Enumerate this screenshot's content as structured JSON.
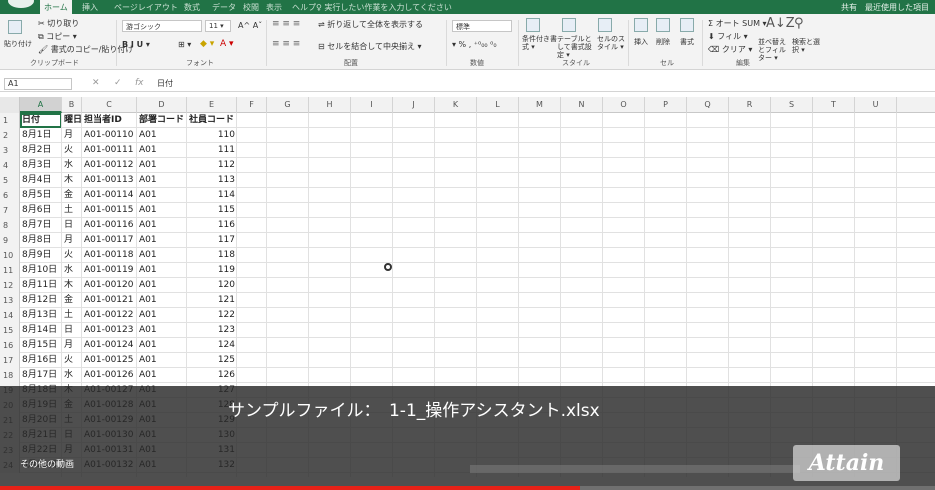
{
  "tabs": [
    "ホーム",
    "挿入",
    "ページレイアウト",
    "数式",
    "データ",
    "校閲",
    "表示",
    "ヘルプ",
    "♀ 実行したい作業を入力してください"
  ],
  "account": "共有　最近使用した項目",
  "ribbon": {
    "paste": "貼り付け",
    "cut": "✂ 切り取り",
    "copy": "⧉ コピー ▾",
    "format_painter": "🖌 書式のコピー/貼り付け",
    "font_name": "游ゴシック",
    "font_size": "11 ▾",
    "font_grow": "A^ Aˇ",
    "biu": "B  I  U ▾",
    "border": "⊞ ▾",
    "fill": "◆ ▾",
    "font_color": "A ▾",
    "align_icons": "≡ ≡ ≡",
    "wrap_text": "⇌ 折り返して全体を表示する",
    "merge_center": "⊟ セルを結合して中央揃え ▾",
    "number_format": "標準",
    "number_buttons": "▾ % , ⁺⁰₀₀ ⁰₀",
    "cond_format": "条件付き書式 ▾",
    "table_format": "テーブルとして書式設定 ▾",
    "cell_styles": "セルのスタイル ▾",
    "insert": "挿入",
    "delete": "削除",
    "format": "書式",
    "autosum": "Σ オート SUM ▾",
    "fill_btn": "⬇ フィル ▾",
    "clear": "⌫ クリア ▾",
    "sort_icon": "A↓Z",
    "find_icon": "⚲",
    "sort_filter": "並べ替えとフィルター ▾",
    "find_select": "検索と選択 ▾",
    "groups": [
      "クリップボード",
      "フォント",
      "配置",
      "数値",
      "スタイル",
      "セル",
      "編集"
    ]
  },
  "formula_bar": {
    "name_box": "A1",
    "cancel": "✕",
    "enter": "✓",
    "fx": "fx",
    "value": "日付"
  },
  "columns": [
    "A",
    "B",
    "C",
    "D",
    "E",
    "F",
    "G",
    "H",
    "I",
    "J",
    "K",
    "L",
    "M",
    "N",
    "O",
    "P",
    "Q",
    "R",
    "S",
    "T",
    "U"
  ],
  "header_row": [
    "日付",
    "曜日",
    "担当者ID",
    "部署コード",
    "社員コード"
  ],
  "rows": [
    [
      "8月1日",
      "月",
      "A01-00110",
      "A01",
      "110"
    ],
    [
      "8月2日",
      "火",
      "A01-00111",
      "A01",
      "111"
    ],
    [
      "8月3日",
      "水",
      "A01-00112",
      "A01",
      "112"
    ],
    [
      "8月4日",
      "木",
      "A01-00113",
      "A01",
      "113"
    ],
    [
      "8月5日",
      "金",
      "A01-00114",
      "A01",
      "114"
    ],
    [
      "8月6日",
      "土",
      "A01-00115",
      "A01",
      "115"
    ],
    [
      "8月7日",
      "日",
      "A01-00116",
      "A01",
      "116"
    ],
    [
      "8月8日",
      "月",
      "A01-00117",
      "A01",
      "117"
    ],
    [
      "8月9日",
      "火",
      "A01-00118",
      "A01",
      "118"
    ],
    [
      "8月10日",
      "水",
      "A01-00119",
      "A01",
      "119"
    ],
    [
      "8月11日",
      "木",
      "A01-00120",
      "A01",
      "120"
    ],
    [
      "8月12日",
      "金",
      "A01-00121",
      "A01",
      "121"
    ],
    [
      "8月13日",
      "土",
      "A01-00122",
      "A01",
      "122"
    ],
    [
      "8月14日",
      "日",
      "A01-00123",
      "A01",
      "123"
    ],
    [
      "8月15日",
      "月",
      "A01-00124",
      "A01",
      "124"
    ],
    [
      "8月16日",
      "火",
      "A01-00125",
      "A01",
      "125"
    ],
    [
      "8月17日",
      "水",
      "A01-00126",
      "A01",
      "126"
    ],
    [
      "8月18日",
      "木",
      "A01-00127",
      "A01",
      "127"
    ],
    [
      "8月19日",
      "金",
      "A01-00128",
      "A01",
      "128"
    ],
    [
      "8月20日",
      "土",
      "A01-00129",
      "A01",
      "129"
    ],
    [
      "8月21日",
      "日",
      "A01-00130",
      "A01",
      "130"
    ],
    [
      "8月22日",
      "月",
      "A01-00131",
      "A01",
      "131"
    ],
    [
      "8月23日",
      "火",
      "A01-00132",
      "A01",
      "132"
    ]
  ],
  "overlay": {
    "caption": "サンプルファイル：　1-1_操作アシスタント.xlsx",
    "more_videos": "その他の動画",
    "brand": "Attain",
    "progress": 0.62
  },
  "colors": {
    "accent": "#217346",
    "progress": "#e62117"
  }
}
